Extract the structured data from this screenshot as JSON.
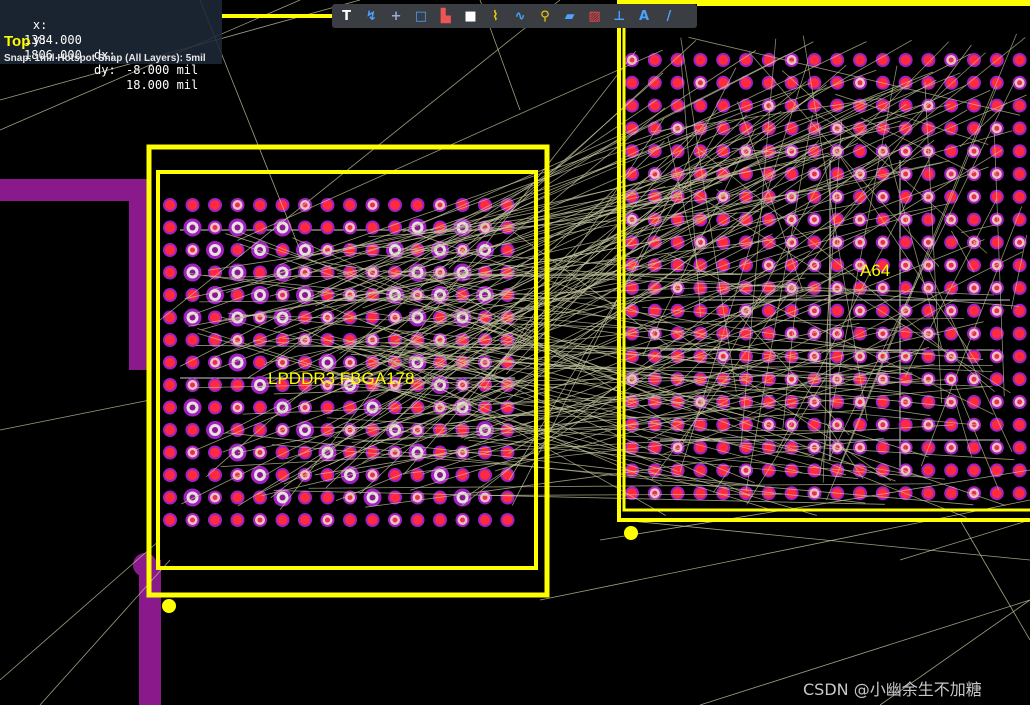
{
  "status": {
    "x_label": "x:",
    "x_value": "1384.000",
    "dx_label": "dx:",
    "dx_value": "-8.000 mil",
    "y_label": "y:",
    "y_value": "1806.000",
    "dy_label": "dy:",
    "dy_value": "18.000 mil",
    "layer": "Top",
    "snap": "Snap: 1mil Hotspot Snap (All Layers): 5mil"
  },
  "toolbar": {
    "tools": [
      {
        "name": "filter-icon"
      },
      {
        "name": "interactive-route-icon"
      },
      {
        "name": "place-cross-icon"
      },
      {
        "name": "select-rect-icon"
      },
      {
        "name": "align-icon"
      },
      {
        "name": "place-pad-icon"
      },
      {
        "name": "route-multiple-icon"
      },
      {
        "name": "differential-pair-icon"
      },
      {
        "name": "place-via-icon"
      },
      {
        "name": "polygon-pour-icon"
      },
      {
        "name": "keepout-icon"
      },
      {
        "name": "dimension-icon"
      },
      {
        "name": "place-string-icon"
      },
      {
        "name": "place-line-icon"
      }
    ],
    "tool_glyphs": [
      "T",
      "↯",
      "+",
      "□",
      "▙",
      "■",
      "⌇",
      "∿",
      "⚲",
      "▰",
      "▨",
      "⊥",
      "A",
      "/"
    ]
  },
  "components": [
    {
      "designator": "LPDDR3_FBGA178",
      "label": "LPDDR3  FBGA178"
    },
    {
      "designator": "A64",
      "label": "A64"
    }
  ],
  "colors": {
    "background": "#000000",
    "silkscreen": "#ffff00",
    "pad": "#ff2a3d",
    "pad_ring": "#a020c0",
    "trace": "#8a1a8c",
    "ratsnest": "#c8c8a0"
  },
  "watermark": "CSDN @小幽余生不加糖"
}
